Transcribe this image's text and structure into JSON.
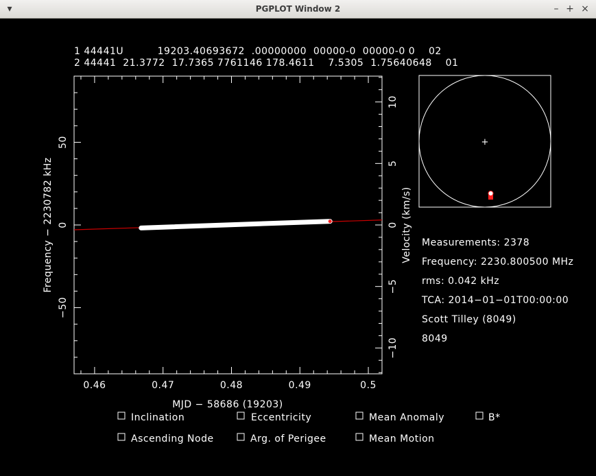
{
  "window": {
    "title": "PGPLOT Window 2",
    "menu_icon": "triangle-down-icon",
    "minimize": "–",
    "maximize": "+",
    "close": "×"
  },
  "tle": {
    "line1": "1 44441U          19203.40693672  .00000000  00000-0  00000-0 0    02",
    "line2": "2 44441  21.3772  17.7365 7761146 178.4611    7.5305  1.75640648    01"
  },
  "chart_data": {
    "type": "scatter",
    "xlabel": "MJD − 58686 (19203)",
    "ylabel": "Frequency − 2230782 kHz",
    "y2label": "Velocity (km/s)",
    "xlim": [
      0.457,
      0.502
    ],
    "ylim": [
      -90,
      90
    ],
    "y2lim": [
      -12.1,
      12.1
    ],
    "xticks": [
      "0.46",
      "0.47",
      "0.48",
      "0.49",
      "0.5"
    ],
    "yticks": [
      "50",
      "0",
      "−50"
    ],
    "y2ticks": [
      "10",
      "5",
      "0",
      "−5",
      "−10"
    ],
    "series": [
      {
        "kind": "measurements",
        "color": "#ffffff",
        "x_start": 0.4668,
        "x_end": 0.4942,
        "y_start": -1.8,
        "y_end": 2.2
      },
      {
        "kind": "model",
        "color": "#cc0000",
        "x": [
          0.457,
          0.502
        ],
        "y": [
          -2.9,
          3.0
        ]
      },
      {
        "kind": "selected",
        "color": "#ff2020",
        "x": [
          0.4944
        ],
        "y": [
          2.2
        ]
      }
    ]
  },
  "globe": {
    "center_marker": "+",
    "marker_colors": [
      "#ffffff",
      "#ff2020"
    ]
  },
  "info": {
    "measurements": "Measurements: 2378",
    "frequency": "Frequency: 2230.800500 MHz",
    "rms": "rms: 0.042 kHz",
    "tca": "TCA: 2014−01−01T00:00:00",
    "observer": "Scott Tilley (8049)",
    "site": "8049",
    "site_color": "#ff2020"
  },
  "options": {
    "inclination": "Inclination",
    "eccentricity": "Eccentricity",
    "mean_anomaly": "Mean Anomaly",
    "bstar": "B*",
    "ascending_node": "Ascending Node",
    "arg_perigee": "Arg. of Perigee",
    "mean_motion": "Mean Motion"
  }
}
